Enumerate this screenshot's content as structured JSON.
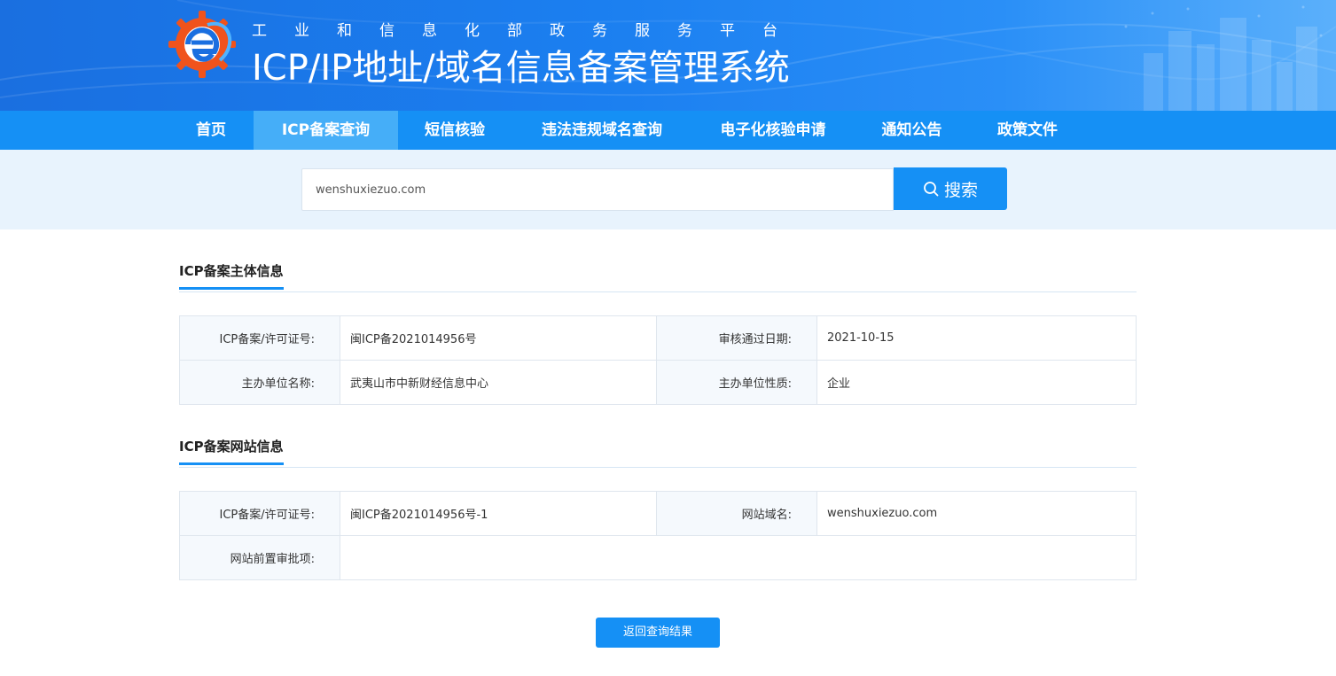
{
  "header": {
    "subtitle": "工业和信息化部政务服务平台",
    "title": "ICP/IP地址/域名信息备案管理系统",
    "logo_icon": "gear-e-logo-icon"
  },
  "nav": {
    "items": [
      {
        "label": "首页",
        "active": false
      },
      {
        "label": "ICP备案查询",
        "active": true
      },
      {
        "label": "短信核验",
        "active": false
      },
      {
        "label": "违法违规域名查询",
        "active": false
      },
      {
        "label": "电子化核验申请",
        "active": false
      },
      {
        "label": "通知公告",
        "active": false
      },
      {
        "label": "政策文件",
        "active": false
      }
    ]
  },
  "search": {
    "value": "wenshuxiezuo.com",
    "button_label": "搜索",
    "button_icon": "search-icon"
  },
  "subject_section": {
    "title": "ICP备案主体信息",
    "rows": [
      [
        {
          "label": "ICP备案/许可证号:",
          "value": "闽ICP备2021014956号"
        },
        {
          "label": "审核通过日期:",
          "value": "2021-10-15"
        }
      ],
      [
        {
          "label": "主办单位名称:",
          "value": "武夷山市中新财经信息中心"
        },
        {
          "label": "主办单位性质:",
          "value": "企业"
        }
      ]
    ]
  },
  "website_section": {
    "title": "ICP备案网站信息",
    "rows": [
      [
        {
          "label": "ICP备案/许可证号:",
          "value": "闽ICP备2021014956号-1"
        },
        {
          "label": "网站域名:",
          "value": "wenshuxiezuo.com"
        }
      ],
      [
        {
          "label": "网站前置审批项:",
          "value": ""
        }
      ]
    ]
  },
  "footer": {
    "back_button_label": "返回查询结果"
  },
  "colors": {
    "primary": "#1590f5",
    "nav_active": "#45aef8",
    "search_band": "#e8f3fd",
    "label_bg": "#f5f9fd"
  }
}
